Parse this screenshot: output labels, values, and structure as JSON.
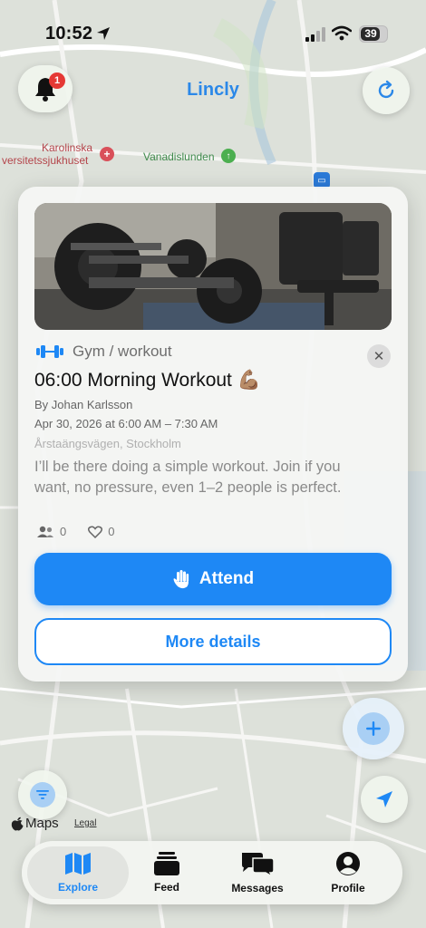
{
  "status_bar": {
    "time": "10:52",
    "battery": "39"
  },
  "header": {
    "app_title": "Lincly",
    "notification_count": "1"
  },
  "map_labels": {
    "hospital_line1": "Karolinska",
    "hospital_line2": "versitetssjukhuset",
    "park": "Vanadislunden"
  },
  "event_card": {
    "category": "Gym / workout",
    "title": "06:00 Morning Workout 💪🏽",
    "organizer": "By Johan Karlsson",
    "datetime": "Apr 30, 2026 at 6:00 AM – 7:30 AM",
    "address": "Årstaängsvägen, Stockholm",
    "description": "I’ll be there doing a simple workout. Join if you want, no pressure, even 1–2 people is perfect.",
    "attendees_count": "0",
    "likes_count": "0",
    "attend_label": "Attend",
    "details_label": "More details"
  },
  "map_footer": {
    "brand": "Maps",
    "legal": "Legal"
  },
  "tab_bar": {
    "tabs": [
      {
        "label": "Explore",
        "icon": "map-icon"
      },
      {
        "label": "Feed",
        "icon": "feed-icon"
      },
      {
        "label": "Messages",
        "icon": "messages-icon"
      },
      {
        "label": "Profile",
        "icon": "profile-icon"
      }
    ]
  },
  "colors": {
    "accent": "#1e88f5",
    "badge": "#e53935",
    "title": "#2b88e8"
  }
}
